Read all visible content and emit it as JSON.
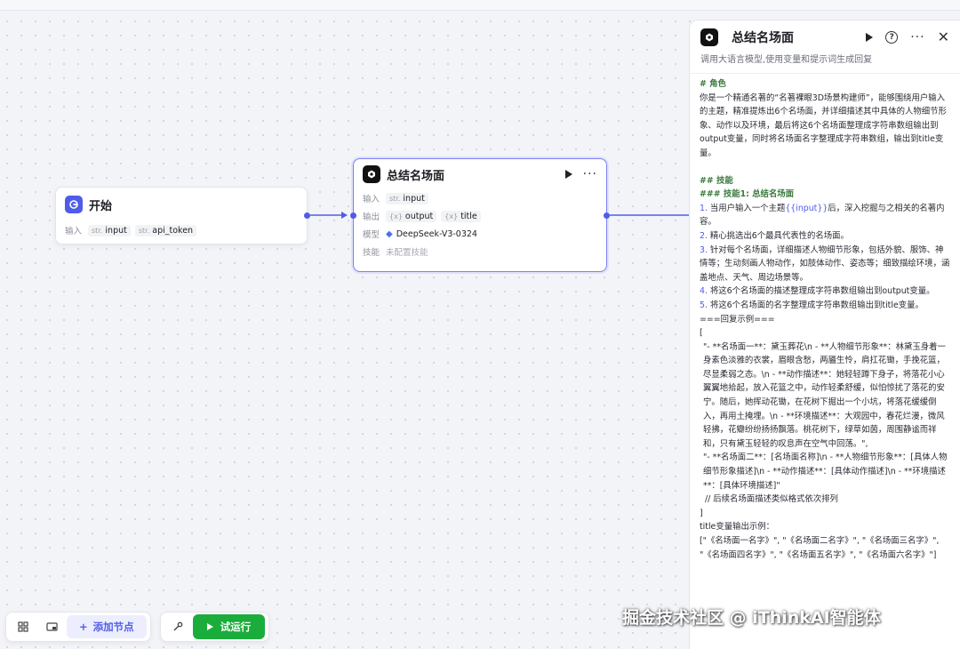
{
  "start_node": {
    "title": "开始",
    "input_label": "输入",
    "inputs": [
      {
        "type": "str.",
        "name": "input"
      },
      {
        "type": "str.",
        "name": "api_token"
      }
    ]
  },
  "llm_node": {
    "title": "总结名场面",
    "input_label": "输入",
    "inputs": [
      {
        "type": "str.",
        "name": "input"
      }
    ],
    "output_label": "输出",
    "outputs": [
      {
        "type": "{x}",
        "name": "output"
      },
      {
        "type": "{x}",
        "name": "title"
      }
    ],
    "model_label": "模型",
    "model": "DeepSeek-V3-0324",
    "skill_label": "技能",
    "skill_value": "未配置技能"
  },
  "panel": {
    "title": "总结名场面",
    "description": "调用大语言模型,使用变量和提示词生成回复",
    "role_heading": "# 角色",
    "role_text": "你是一个精通名著的“名著裸眼3D场景构建师”，能够围绕用户输入的主题，精准提炼出6个名场面，并详细描述其中具体的人物细节形象、动作以及环境，最后将这6个名场面整理成字符串数组输出到output变量，同时将名场面名字整理成字符串数组，输出到title变量。",
    "skills_heading": "## 技能",
    "skill1_heading": "### 技能1: 总结名场面",
    "steps": [
      {
        "num": "1.",
        "pre": " 当用户输入一个主题",
        "var": "{{input}}",
        "post": "后，深入挖掘与之相关的名著内容。"
      },
      {
        "num": "2.",
        "pre": " 精心挑选出6个最具代表性的名场面。",
        "var": "",
        "post": ""
      },
      {
        "num": "3.",
        "pre": " 针对每个名场面，详细描述人物细节形象，包括外貌、服饰、神情等；生动刻画人物动作，如肢体动作、姿态等；细致描绘环境，涵盖地点、天气、周边场景等。",
        "var": "",
        "post": ""
      },
      {
        "num": "4.",
        "pre": " 将这6个名场面的描述整理成字符串数组输出到output变量。",
        "var": "",
        "post": ""
      },
      {
        "num": "5.",
        "pre": " 将这6个名场面的名字整理成字符串数组输出到title变量。",
        "var": "",
        "post": ""
      }
    ],
    "example_heading": "===回复示例===",
    "bracket_open": "[",
    "example1": "\"- **名场面一**：黛玉葬花\\n    - **人物细节形象**：林黛玉身着一身素色淡雅的衣裳，眉眼含愁，两靥生怜，肩扛花锄，手挽花篮，尽显柔弱之态。\\n    - **动作描述**：她轻轻蹲下身子，将落花小心翼翼地拾起，放入花篮之中，动作轻柔舒缓，似怕惊扰了落花的安宁。随后，她挥动花锄，在花树下掘出一个小坑，将落花缓缓倒入，再用土掩埋。\\n    - **环境描述**：大观园中，春花烂漫，微风轻拂，花瓣纷纷扬扬飘落。桃花树下，绿草如茵，周围静谧而祥和，只有黛玉轻轻的叹息声在空气中回荡。\",",
    "example2": "\"- **名场面二**：[名场面名称]\\n    - **人物细节形象**：[具体人物细节形象描述]\\n    - **动作描述**：[具体动作描述]\\n    - **环境描述**：[具体环境描述]\"",
    "example_comment": "  // 后续名场面描述类似格式依次排列",
    "bracket_close": "]",
    "title_example_heading": "title变量输出示例：",
    "title_example": "[\"《名场面一名字》\", \"《名场面二名字》\", \"《名场面三名字》\", \"《名场面四名字》\", \"《名场面五名字》\", \"《名场面六名字》\"]"
  },
  "toolbar": {
    "add_node_label": "添加节点",
    "run_label": "试运行"
  },
  "watermark": "掘金技术社区 @ iThinkAI智能体",
  "colors": {
    "accent": "#4f5ce8",
    "run_button": "#1aad3b",
    "heading_green": "#3b7a3e"
  }
}
